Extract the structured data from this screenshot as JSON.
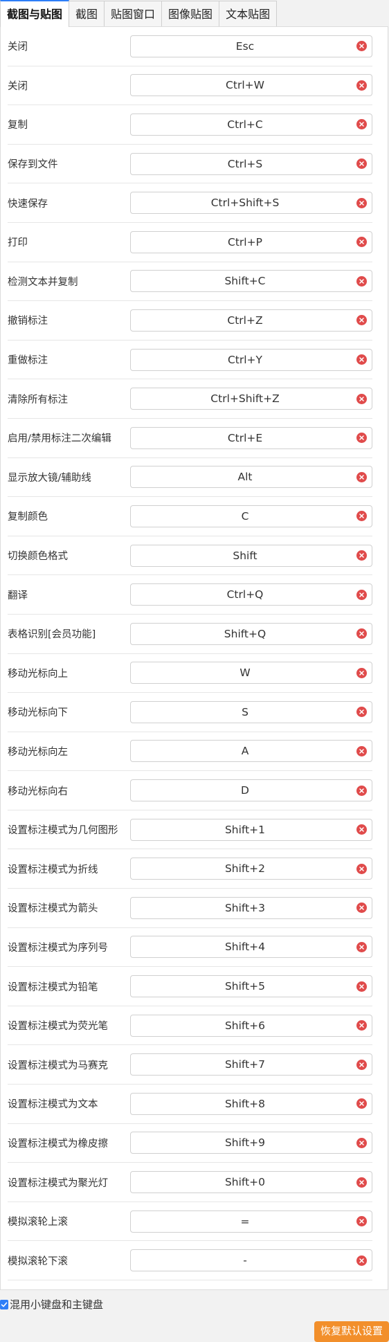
{
  "tabs": [
    {
      "label": "截图与贴图",
      "active": true
    },
    {
      "label": "截图",
      "active": false
    },
    {
      "label": "贴图窗口",
      "active": false
    },
    {
      "label": "图像贴图",
      "active": false
    },
    {
      "label": "文本贴图",
      "active": false
    }
  ],
  "shortcuts": [
    {
      "label": "关闭",
      "key": "Esc"
    },
    {
      "label": "关闭",
      "key": "Ctrl+W"
    },
    {
      "label": "复制",
      "key": "Ctrl+C"
    },
    {
      "label": "保存到文件",
      "key": "Ctrl+S"
    },
    {
      "label": "快速保存",
      "key": "Ctrl+Shift+S"
    },
    {
      "label": "打印",
      "key": "Ctrl+P"
    },
    {
      "label": "检测文本并复制",
      "key": "Shift+C"
    },
    {
      "label": "撤销标注",
      "key": "Ctrl+Z"
    },
    {
      "label": "重做标注",
      "key": "Ctrl+Y"
    },
    {
      "label": "清除所有标注",
      "key": "Ctrl+Shift+Z"
    },
    {
      "label": "启用/禁用标注二次编辑",
      "key": "Ctrl+E"
    },
    {
      "label": "显示放大镜/辅助线",
      "key": "Alt"
    },
    {
      "label": "复制颜色",
      "key": "C"
    },
    {
      "label": "切换颜色格式",
      "key": "Shift"
    },
    {
      "label": "翻译",
      "key": "Ctrl+Q"
    },
    {
      "label": "表格识别[会员功能]",
      "key": "Shift+Q"
    },
    {
      "label": "移动光标向上",
      "key": "W"
    },
    {
      "label": "移动光标向下",
      "key": "S"
    },
    {
      "label": "移动光标向左",
      "key": "A"
    },
    {
      "label": "移动光标向右",
      "key": "D"
    },
    {
      "label": "设置标注模式为几何图形",
      "key": "Shift+1"
    },
    {
      "label": "设置标注模式为折线",
      "key": "Shift+2"
    },
    {
      "label": "设置标注模式为箭头",
      "key": "Shift+3"
    },
    {
      "label": "设置标注模式为序列号",
      "key": "Shift+4"
    },
    {
      "label": "设置标注模式为铅笔",
      "key": "Shift+5"
    },
    {
      "label": "设置标注模式为荧光笔",
      "key": "Shift+6"
    },
    {
      "label": "设置标注模式为马赛克",
      "key": "Shift+7"
    },
    {
      "label": "设置标注模式为文本",
      "key": "Shift+8"
    },
    {
      "label": "设置标注模式为橡皮擦",
      "key": "Shift+9"
    },
    {
      "label": "设置标注模式为聚光灯",
      "key": "Shift+0"
    },
    {
      "label": "模拟滚轮上滚",
      "key": "="
    },
    {
      "label": "模拟滚轮下滚",
      "key": "-"
    }
  ],
  "footer": {
    "checkbox_label": "混用小键盘和主键盘",
    "checkbox_checked": true,
    "restore_label": "恢复默认设置"
  },
  "colors": {
    "accent": "#2d7ef7",
    "clear_icon": "#e04b4b",
    "restore_button": "#f28f2b"
  }
}
